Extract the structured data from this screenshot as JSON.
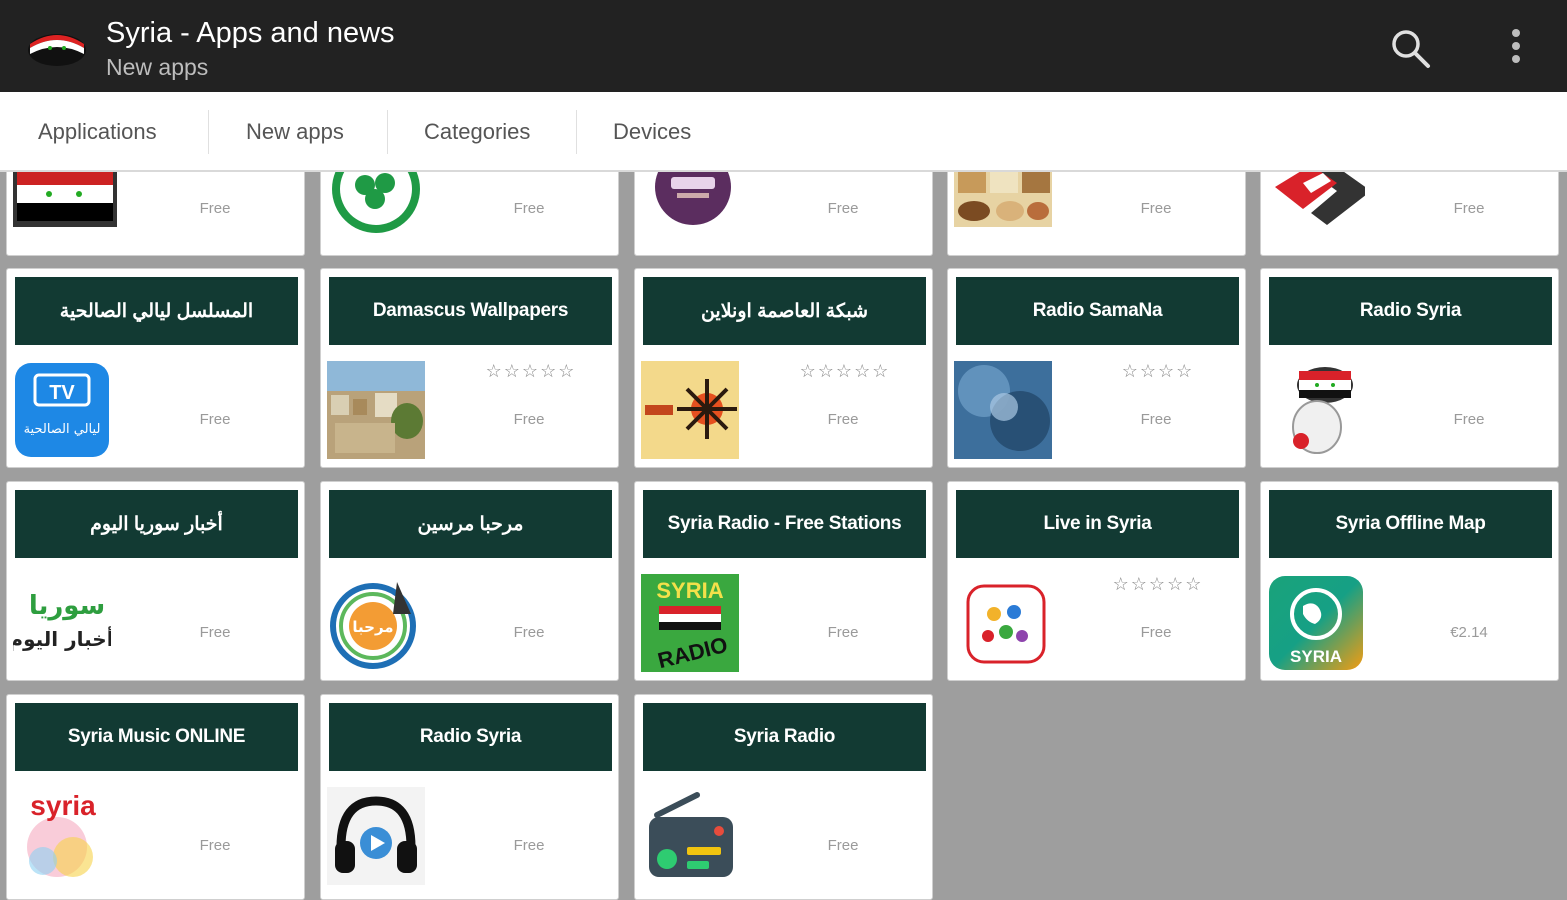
{
  "app_bar": {
    "title": "Syria - Apps and news",
    "subtitle": "New apps",
    "logo_icon": "syria-flag-icon",
    "search_icon": "search-icon",
    "menu_icon": "overflow-menu-icon"
  },
  "tabs": [
    {
      "label": "Applications"
    },
    {
      "label": "New apps"
    },
    {
      "label": "Categories"
    },
    {
      "label": "Devices"
    }
  ],
  "top_row": [
    {
      "price": "Free",
      "icon": "syria-flag-photo-icon"
    },
    {
      "price": "Free",
      "icon": "green-clover-icon"
    },
    {
      "price": "Free",
      "icon": "purple-badge-logo-icon"
    },
    {
      "price": "Free",
      "icon": "food-photo-icon"
    },
    {
      "price": "Free",
      "icon": "red-s-logo-icon"
    }
  ],
  "apps": [
    {
      "name": "المسلسل ليالي الصالحية",
      "price": "Free",
      "rating": "",
      "icon": "tv-app-icon",
      "icon_text": "TV",
      "icon_caption": "ليالي الصالحية"
    },
    {
      "name": "Damascus Wallpapers",
      "price": "Free",
      "rating": "☆☆☆☆☆",
      "icon": "city-photo-icon"
    },
    {
      "name": "شبكة العاصمة اونلاين",
      "price": "Free",
      "rating": "☆☆☆☆☆",
      "icon": "network-logo-icon"
    },
    {
      "name": "Radio SamaNa",
      "price": "Free",
      "rating": "☆☆☆☆",
      "icon": "blue-abstract-icon"
    },
    {
      "name": "Radio Syria",
      "price": "Free",
      "rating": "",
      "icon": "flag-character-icon"
    },
    {
      "name": "أخبار سوريا اليوم",
      "price": "Free",
      "rating": "",
      "icon": "syria-news-logo-icon",
      "icon_text": "سوريا",
      "icon_caption": "أخبار اليوم"
    },
    {
      "name": "مرحبا مرسين",
      "price": "Free",
      "rating": "",
      "icon": "welcome-mersin-logo-icon",
      "icon_text": "مرحبا"
    },
    {
      "name": "Syria Radio - Free Stations",
      "price": "Free",
      "rating": "",
      "icon": "syria-radio-logo-icon",
      "icon_text": "SYRIA",
      "icon_caption": "RADIO"
    },
    {
      "name": "Live in Syria",
      "price": "Free",
      "rating": "☆☆☆☆☆",
      "icon": "colorful-figures-icon"
    },
    {
      "name": "Syria Offline Map",
      "price": "€2.14",
      "rating": "",
      "icon": "globe-map-icon",
      "icon_text": "SYRIA"
    },
    {
      "name": "Syria Music ONLINE",
      "price": "Free",
      "rating": "",
      "icon": "syria-music-logo-icon",
      "icon_text": "syria"
    },
    {
      "name": "Radio Syria",
      "price": "Free",
      "rating": "",
      "icon": "headphones-icon"
    },
    {
      "name": "Syria Radio",
      "price": "Free",
      "rating": "",
      "icon": "radio-device-icon"
    }
  ]
}
